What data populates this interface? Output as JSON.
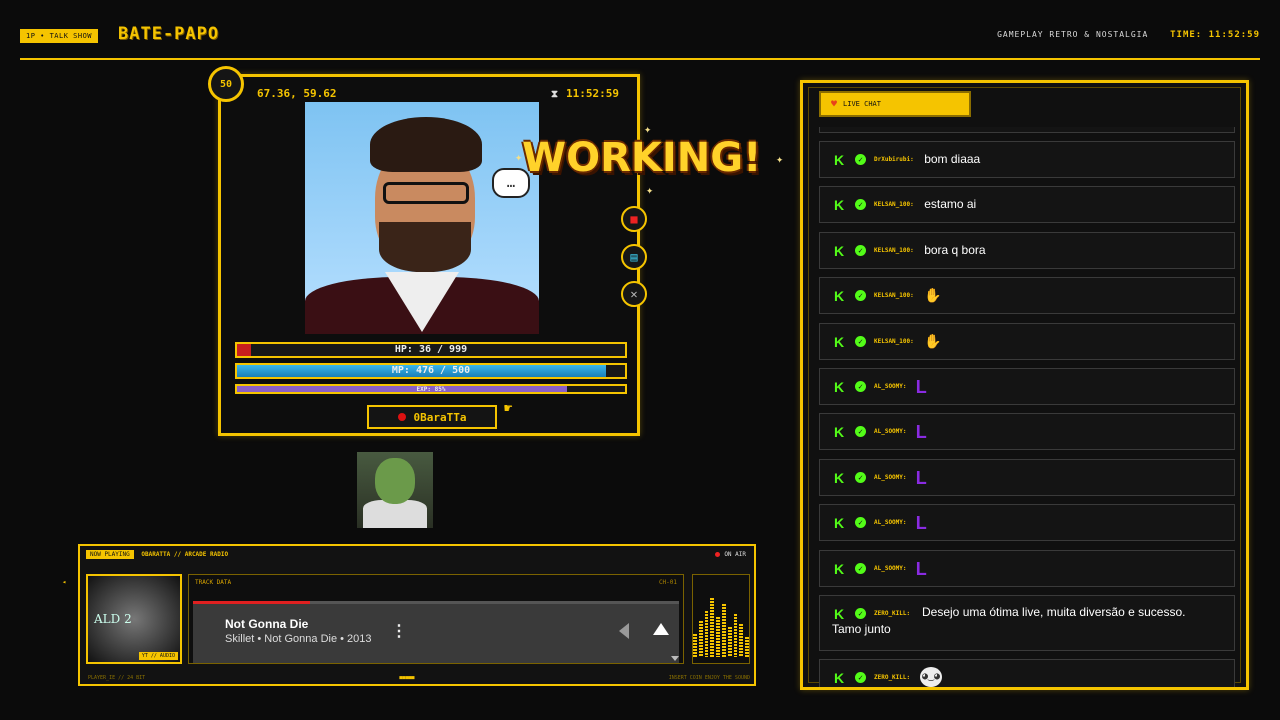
{
  "header": {
    "tag": "1P • TALK SHOW",
    "brand": "BATE-PAPO",
    "subtitle": "GAMEPLAY RETRO & NOSTALGIA",
    "clock_label": "TIME:",
    "clock": "11:52:59"
  },
  "profile": {
    "level": "50",
    "coords": "67.36, 59.62",
    "time": "11:52:59",
    "overlay": "WORKING!",
    "speech": "…",
    "hp_label": "HP: 36 / 999",
    "hp_fraction": 0.036,
    "mp_label": "MP: 476 / 500",
    "mp_fraction": 0.952,
    "exp_label": "EXP: 85%",
    "exp_fraction": 0.85,
    "name": "0BaraTTa",
    "side_buttons": [
      "record-icon",
      "book-icon",
      "close-icon"
    ],
    "colors": {
      "accent": "#f5c400",
      "hp": "#c81e1e",
      "mp": "#2aa6e0",
      "exp": "#8a5fc8"
    }
  },
  "player": {
    "now_playing": "NOW PLAYING",
    "station": "OBARATTA // ARCADE RADIO",
    "on_air": "ON AIR",
    "cover_text": "ALD 2",
    "cover_badge": "YT // AUDIO",
    "track_label": "TRACK DATA",
    "track_code": "CH-01",
    "title": "Not Gonna Die",
    "subtitle": "Skillet • Not Gonna Die • 2013",
    "progress": 0.24,
    "footer_left": "PLAYER_IE // 24 BIT",
    "footer_mid": "■■■■■",
    "footer_right": "INSERT COIN    ENJOY THE SOUND",
    "eq_levels": [
      0.35,
      0.55,
      0.7,
      0.9,
      0.6,
      0.8,
      0.45,
      0.65,
      0.5,
      0.3
    ]
  },
  "chat": {
    "title": "LIVE CHAT",
    "messages": [
      {
        "user": "DrXubirubi:",
        "text": "bom diaaa",
        "kind": "text"
      },
      {
        "user": "KELSAN_100:",
        "text": "estamo ai",
        "kind": "text"
      },
      {
        "user": "KELSAN_100:",
        "text": "bora q bora",
        "kind": "text"
      },
      {
        "user": "KELSAN_100:",
        "text": "",
        "kind": "wave"
      },
      {
        "user": "KELSAN_100:",
        "text": "",
        "kind": "wave"
      },
      {
        "user": "AL_SOOMY:",
        "text": "L",
        "kind": "L"
      },
      {
        "user": "AL_SOOMY:",
        "text": "L",
        "kind": "L"
      },
      {
        "user": "AL_SOOMY:",
        "text": "L",
        "kind": "L"
      },
      {
        "user": "AL_SOOMY:",
        "text": "L",
        "kind": "L"
      },
      {
        "user": "AL_SOOMY:",
        "text": "L",
        "kind": "L"
      },
      {
        "user": "ZERO_KILL:",
        "text": "Desejo uma ótima live, muita diversão e sucesso. Tamo junto",
        "kind": "wrap"
      },
      {
        "user": "ZERO_KILL:",
        "text": "",
        "kind": "round"
      }
    ]
  }
}
